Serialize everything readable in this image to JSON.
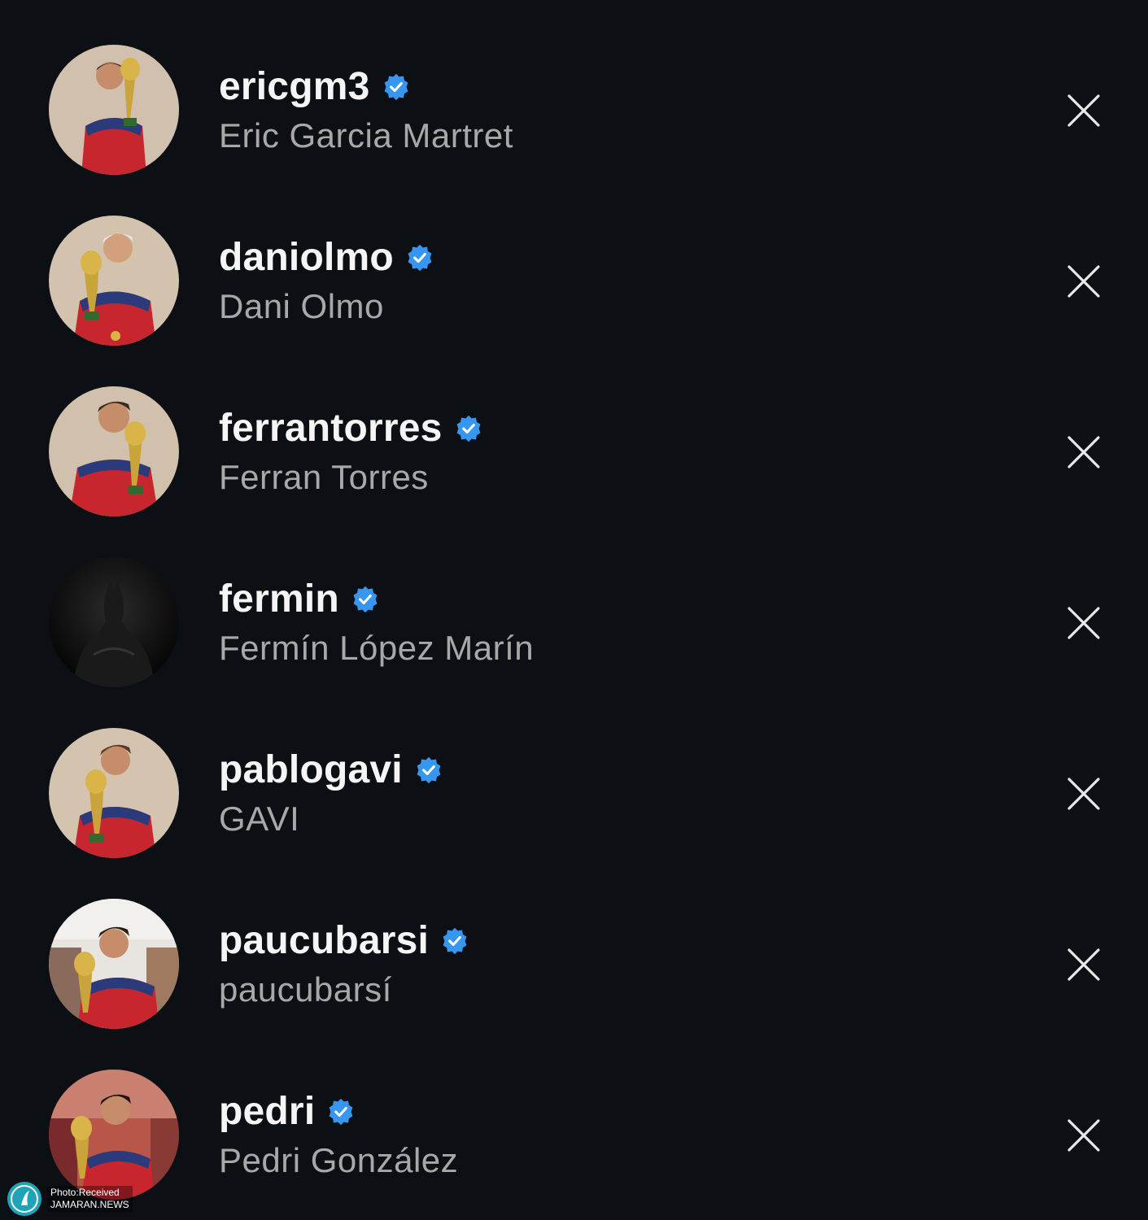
{
  "suggestions": [
    {
      "username": "ericgm3",
      "full_name": "Eric Garcia Martret",
      "avatar": "player-holding-trophy"
    },
    {
      "username": "daniolmo",
      "full_name": "Dani Olmo",
      "avatar": "player-kissing-trophy"
    },
    {
      "username": "ferrantorres",
      "full_name": "Ferran Torres",
      "avatar": "player-kissing-trophy"
    },
    {
      "username": "fermin",
      "full_name": "Fermín López Marín",
      "avatar": "dark-batman-silhouette"
    },
    {
      "username": "pablogavi",
      "full_name": "GAVI",
      "avatar": "player-kissing-trophy"
    },
    {
      "username": "paucubarsi",
      "full_name": "paucubarsí",
      "avatar": "player-kissing-trophy-stadium"
    },
    {
      "username": "pedri",
      "full_name": "Pedri González",
      "avatar": "player-kissing-trophy-stadium"
    }
  ],
  "icons": {
    "verified": "verified-badge-icon",
    "remove": "close-icon"
  },
  "colors": {
    "background": "#0c1014",
    "username": "#f5f5f5",
    "full_name": "#a8a8a8",
    "verified": "#3797f0",
    "close": "#e8e8e8"
  },
  "watermark": {
    "line1": "Photo:Received",
    "line2": "JAMARAN.NEWS"
  }
}
